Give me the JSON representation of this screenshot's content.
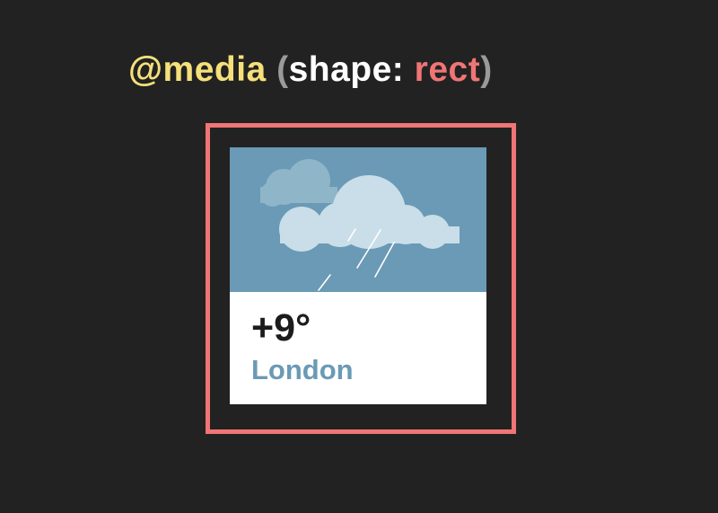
{
  "heading": {
    "keyword": "@media",
    "open_paren": "(",
    "feature": "shape:",
    "value": "rect",
    "close_paren": ")"
  },
  "weather_card": {
    "icon": "cloud-rain-icon",
    "temperature": "+9°",
    "city": "London"
  },
  "colors": {
    "background": "#222222",
    "frame": "#f07575",
    "sky": "#6a9ab5",
    "cloud_front": "#c9dee8",
    "cloud_back": "#8fb5c9",
    "keyword": "#f5e07a",
    "value": "#f07575"
  }
}
